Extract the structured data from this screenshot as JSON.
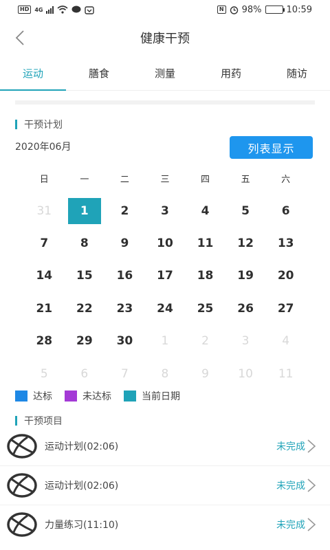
{
  "status_bar": {
    "left_chip": "HD",
    "network": "4G",
    "right_chip": "N",
    "battery_percent": "98%",
    "time": "10:59"
  },
  "nav": {
    "title": "健康干预"
  },
  "tabs": [
    {
      "label": "运动",
      "active": true
    },
    {
      "label": "膳食",
      "active": false
    },
    {
      "label": "测量",
      "active": false
    },
    {
      "label": "用药",
      "active": false
    },
    {
      "label": "随访",
      "active": false
    }
  ],
  "plan_section": {
    "title": "干预计划"
  },
  "calendar": {
    "month": "2020年06月",
    "list_button": "列表显示",
    "weekdays": [
      "日",
      "一",
      "二",
      "三",
      "四",
      "五",
      "六"
    ],
    "days": [
      {
        "d": "31",
        "other": true
      },
      {
        "d": "1",
        "today": true
      },
      {
        "d": "2"
      },
      {
        "d": "3"
      },
      {
        "d": "4"
      },
      {
        "d": "5"
      },
      {
        "d": "6"
      },
      {
        "d": "7"
      },
      {
        "d": "8"
      },
      {
        "d": "9"
      },
      {
        "d": "10"
      },
      {
        "d": "11"
      },
      {
        "d": "12"
      },
      {
        "d": "13"
      },
      {
        "d": "14"
      },
      {
        "d": "15"
      },
      {
        "d": "16"
      },
      {
        "d": "17"
      },
      {
        "d": "18"
      },
      {
        "d": "19"
      },
      {
        "d": "20"
      },
      {
        "d": "21"
      },
      {
        "d": "22"
      },
      {
        "d": "23"
      },
      {
        "d": "24"
      },
      {
        "d": "25"
      },
      {
        "d": "26"
      },
      {
        "d": "27"
      },
      {
        "d": "28"
      },
      {
        "d": "29"
      },
      {
        "d": "30"
      },
      {
        "d": "1",
        "other": true
      },
      {
        "d": "2",
        "other": true
      },
      {
        "d": "3",
        "other": true
      },
      {
        "d": "4",
        "other": true
      },
      {
        "d": "5",
        "other": true
      },
      {
        "d": "6",
        "other": true
      },
      {
        "d": "7",
        "other": true
      },
      {
        "d": "8",
        "other": true
      },
      {
        "d": "9",
        "other": true
      },
      {
        "d": "10",
        "other": true
      },
      {
        "d": "11",
        "other": true
      }
    ]
  },
  "legend": [
    {
      "label": "达标",
      "color": "#1e88e5"
    },
    {
      "label": "未达标",
      "color": "#a43ad6"
    },
    {
      "label": "当前日期",
      "color": "#1fa3b8"
    }
  ],
  "items_section": {
    "title": "干预项目"
  },
  "tasks": [
    {
      "name": "运动计划(02:06)",
      "status": "未完成",
      "icon": "basketball-icon"
    },
    {
      "name": "运动计划(02:06)",
      "status": "未完成",
      "icon": "basketball-icon"
    },
    {
      "name": "力量练习(11:10)",
      "status": "未完成",
      "icon": "basketball-icon"
    }
  ],
  "colors": {
    "accent": "#1fa3b8",
    "button": "#1e96ee"
  }
}
